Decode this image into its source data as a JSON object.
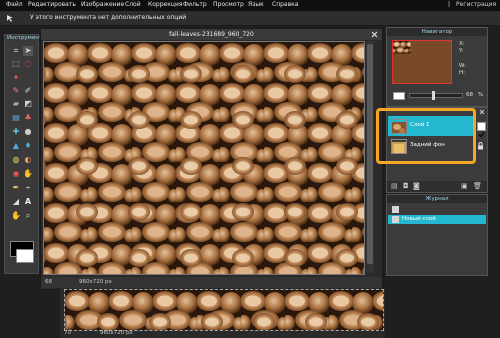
{
  "menu": {
    "items": [
      "Файл",
      "Редактировать",
      "Изображение",
      "Слой",
      "Коррекция",
      "Фильтр",
      "Просмотр",
      "Язык",
      "Справка"
    ],
    "right_divider": "|",
    "register": "Регистрация"
  },
  "options_bar": {
    "message": "У этого инструмента нет дополнительных опций"
  },
  "toolbox": {
    "title": "Инструменты"
  },
  "document": {
    "title": "fall-leaves-231689_960_720",
    "zoom": "68",
    "size": "960x720 px"
  },
  "document2": {
    "zoom": "70",
    "size": "960x720 px"
  },
  "navigator": {
    "title": "Навигатор",
    "labels": [
      "X:",
      "Y:",
      "W:",
      "H:"
    ],
    "zoom": "68",
    "zoom_unit": "%"
  },
  "layers": {
    "items": [
      {
        "label": "Слой 1",
        "selected": true
      },
      {
        "label": "Задний фон",
        "selected": false
      }
    ]
  },
  "history": {
    "title": "Журнал",
    "items": [
      {
        "label": "",
        "selected": false
      },
      {
        "label": "Новый слой",
        "selected": true
      }
    ]
  },
  "colors": {
    "accent": "#23b8cf",
    "highlight": "#f5a623",
    "panel": "#3b3b3b"
  }
}
